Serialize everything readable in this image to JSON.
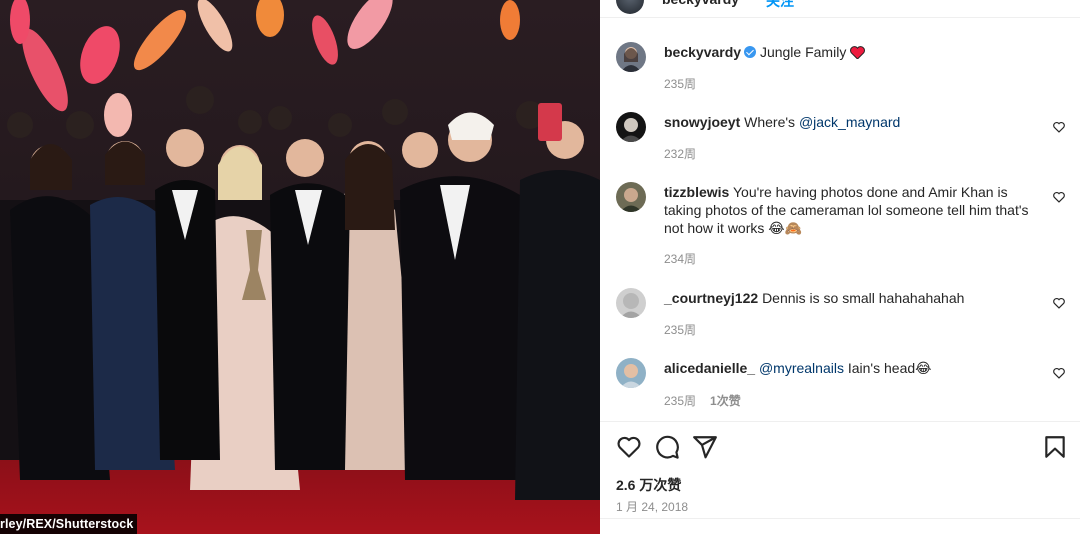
{
  "photo": {
    "credit": "rley/REX/Shutterstock"
  },
  "header": {
    "username": "beckyvardy",
    "follow": "关注"
  },
  "caption": {
    "username": "beckyvardy",
    "verified": true,
    "text": "Jungle Family",
    "emoji": "❤️",
    "time": "235周"
  },
  "comments": [
    {
      "username": "snowyjoeyt",
      "text_prefix": "Where's ",
      "mention": "@jack_maynard",
      "text_suffix": "",
      "time": "232周",
      "likes": ""
    },
    {
      "username": "tizzblewis",
      "text_prefix": "You're having photos done and Amir Khan is taking photos of the cameraman lol someone tell him that's not how it works 😂🙈",
      "mention": "",
      "text_suffix": "",
      "time": "234周",
      "likes": ""
    },
    {
      "username": "_courtneyj122",
      "text_prefix": "Dennis is so small hahahahahah",
      "mention": "",
      "text_suffix": "",
      "time": "235周",
      "likes": ""
    },
    {
      "username": "alicedanielle_",
      "text_prefix": "",
      "mention": "@myrealnails",
      "text_suffix": " Iain's head😂",
      "time": "235周",
      "likes": "1次赞"
    }
  ],
  "icons": [
    "heart-icon",
    "comment-icon",
    "share-icon",
    "bookmark-icon"
  ],
  "footer": {
    "likes": "2.6 万次赞",
    "date": "1 月 24, 2018"
  },
  "colors": {
    "accent": "#0095f6",
    "verified": "#3897f0",
    "muted": "#8e8e8e",
    "mention": "#00376b",
    "heart_red": "#ed1c3f"
  }
}
